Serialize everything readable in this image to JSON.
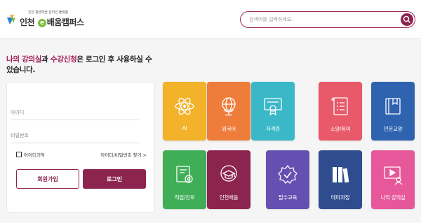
{
  "header": {
    "logo": {
      "tagline": "인천 평생학습 온라인 플랫폼",
      "name_part1": "인천",
      "name_e": "e",
      "name_part2": "배움캠퍼스"
    },
    "search": {
      "placeholder": "검색어를 입력하세요.",
      "value": ""
    }
  },
  "headline": {
    "accent1": "나의 강의실",
    "conj": "과 ",
    "accent2": "수강신청",
    "rest": "은 로그인 후 사용하실 수 있습니다."
  },
  "login": {
    "id_placeholder": "아이디",
    "pw_placeholder": "비밀번호",
    "remember_label": "아이디기억",
    "remember_checked": false,
    "find_link": "아이디/비밀번호 찾기 >",
    "join_button": "회원가입",
    "login_button": "로그인"
  },
  "tiles": [
    {
      "label": "AI",
      "icon": "atom-icon",
      "color": "#f2b22a"
    },
    {
      "label": "외국어",
      "icon": "globe-icon",
      "color": "#ee7d3c"
    },
    {
      "label": "자격증",
      "icon": "certificate-icon",
      "color": "#3ab8c7"
    },
    {
      "label": "소양/취미",
      "icon": "scroll-icon",
      "color": "#e8596a"
    },
    {
      "label": "인문교양",
      "icon": "book-icon",
      "color": "#2f63b0"
    },
    {
      "label": "직업/진로",
      "icon": "career-icon",
      "color": "#3fae57"
    },
    {
      "label": "인천배움",
      "icon": "graduation-cap-icon",
      "color": "#8c2450"
    },
    {
      "label": "필수교육",
      "icon": "badge-check-icon",
      "color": "#6550b2"
    },
    {
      "label": "테마과정",
      "icon": "books-shelf-icon",
      "color": "#2f4c8e"
    },
    {
      "label": "나의 강의실",
      "icon": "video-lecture-icon",
      "color": "#e6589a"
    }
  ]
}
